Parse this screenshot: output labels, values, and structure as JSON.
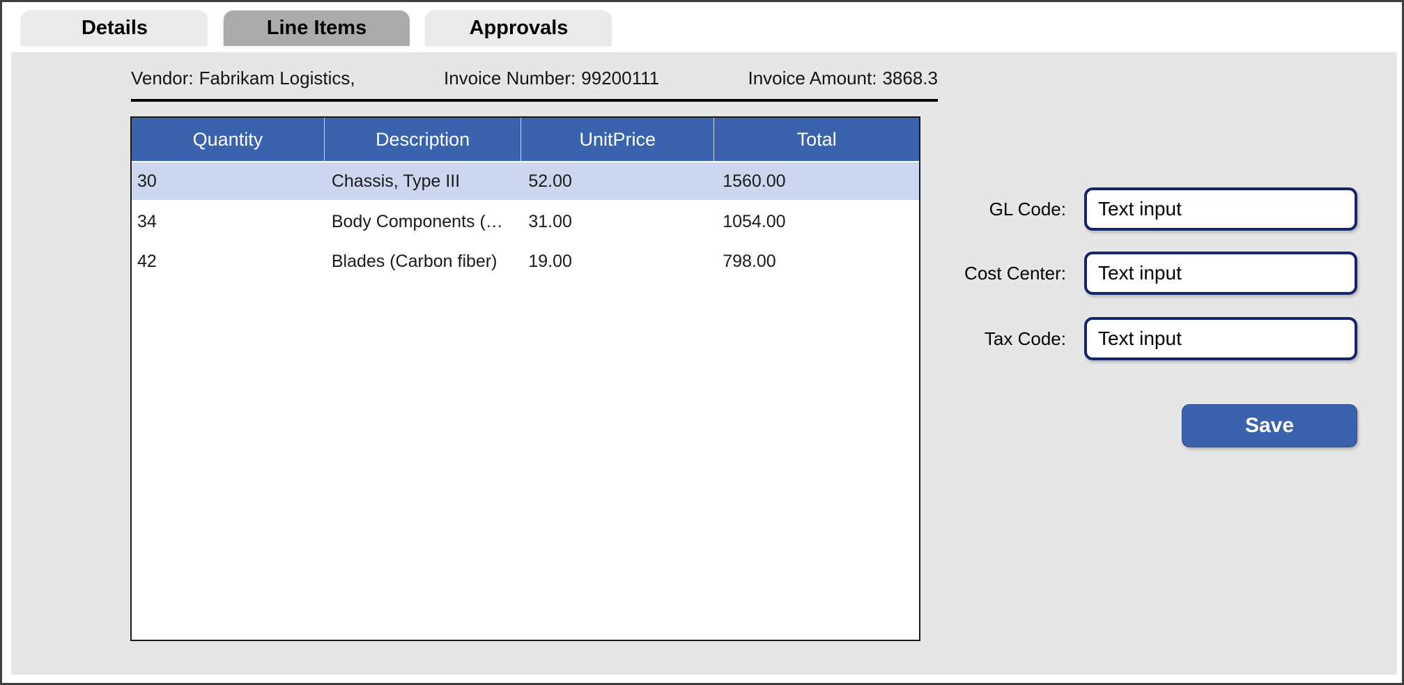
{
  "tabs": [
    {
      "label": "Details",
      "active": false
    },
    {
      "label": "Line Items",
      "active": true
    },
    {
      "label": "Approvals",
      "active": false
    }
  ],
  "invoice_header": {
    "fields": [
      {
        "label": "Vendor:",
        "value": "Fabrikam Logistics,"
      },
      {
        "label": "Invoice Number:",
        "value": "99200111"
      },
      {
        "label": "Invoice Amount:",
        "value": "3868.3"
      }
    ]
  },
  "line_items_table": {
    "columns": [
      "Quantity",
      "Description",
      "UnitPrice",
      "Total"
    ],
    "rows": [
      {
        "quantity": "30",
        "description": "Chassis, Type III",
        "unit_price": "52.00",
        "total": "1560.00",
        "selected": true
      },
      {
        "quantity": "34",
        "description": "Body Components (…",
        "unit_price": "31.00",
        "total": "1054.00",
        "selected": false
      },
      {
        "quantity": "42",
        "description": "Blades (Carbon fiber)",
        "unit_price": "19.00",
        "total": "798.00",
        "selected": false
      }
    ]
  },
  "coding_form": {
    "fields": [
      {
        "label": "GL Code:",
        "value": "Text input"
      },
      {
        "label": "Cost Center:",
        "value": "Text input"
      },
      {
        "label": "Tax Code:",
        "value": "Text input"
      }
    ],
    "save_label": "Save"
  },
  "colors": {
    "accent_blue": "#3A62AD",
    "selected_row_blue": "#CCD6EE",
    "panel_gray": "#E6E6E6",
    "inactive_tab_gray": "#EAEAEA",
    "active_tab_gray": "#ABABAB",
    "input_border_navy": "#15246C"
  }
}
